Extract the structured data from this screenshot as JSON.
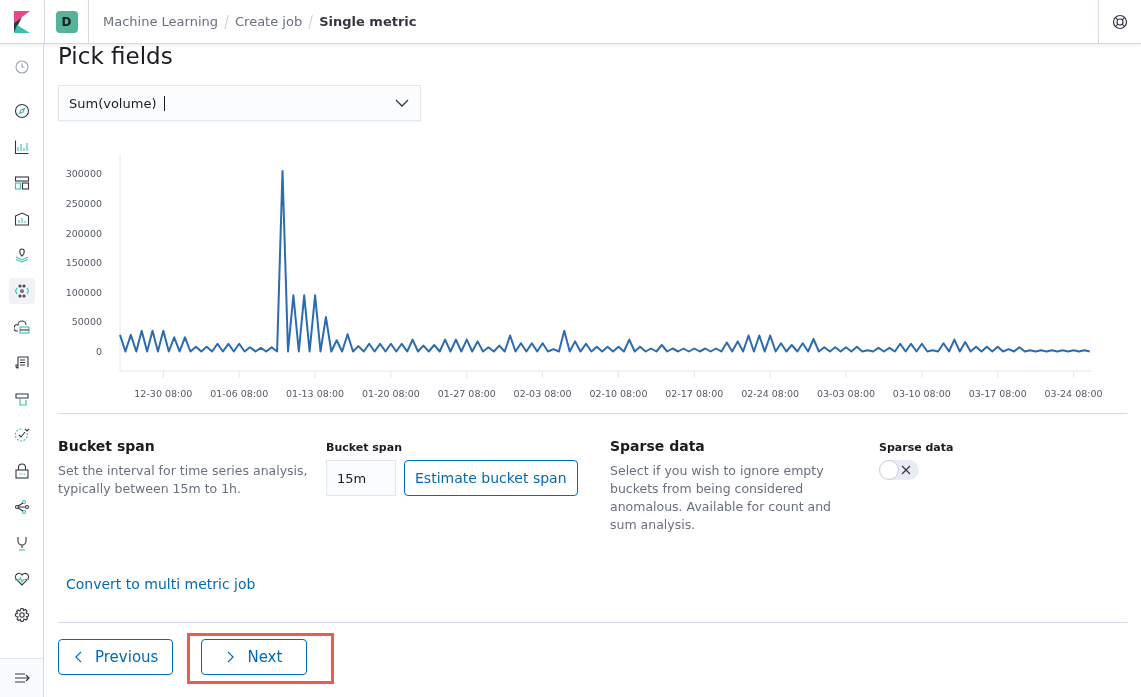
{
  "header": {
    "space_initial": "D",
    "breadcrumbs": [
      {
        "label": "Machine Learning",
        "current": false
      },
      {
        "label": "Create job",
        "current": false
      },
      {
        "label": "Single metric",
        "current": true
      }
    ]
  },
  "sidebar": {
    "items": [
      {
        "selected": false
      },
      {
        "selected": false
      },
      {
        "selected": false
      },
      {
        "selected": false
      },
      {
        "selected": false
      },
      {
        "selected": false
      },
      {
        "selected": true
      },
      {
        "selected": false
      },
      {
        "selected": false
      },
      {
        "selected": false
      },
      {
        "selected": false
      },
      {
        "selected": false
      },
      {
        "selected": false
      },
      {
        "selected": false
      },
      {
        "selected": false
      },
      {
        "selected": false
      }
    ]
  },
  "title": "Pick fields",
  "field_select": {
    "value": "Sum(volume)"
  },
  "chart_data": {
    "type": "line",
    "categories": [
      null,
      null,
      null,
      null,
      null,
      null,
      null,
      null,
      "12-30 08:00",
      null,
      null,
      null,
      null,
      null,
      null,
      null,
      null,
      null,
      null,
      null,
      null,
      null,
      "01-06 08:00",
      null,
      null,
      null,
      null,
      null,
      null,
      null,
      null,
      null,
      null,
      null,
      null,
      null,
      "01-13 08:00",
      null,
      null,
      null,
      null,
      null,
      null,
      null,
      null,
      null,
      null,
      null,
      null,
      null,
      "01-20 08:00",
      null,
      null,
      null,
      null,
      null,
      null,
      null,
      null,
      null,
      null,
      null,
      null,
      null,
      "01-27 08:00",
      null,
      null,
      null,
      null,
      null,
      null,
      null,
      null,
      null,
      null,
      null,
      null,
      null,
      "02-03 08:00",
      null,
      null,
      null,
      null,
      null,
      null,
      null,
      null,
      null,
      null,
      null,
      null,
      null,
      "02-10 08:00",
      null,
      null,
      null,
      null,
      null,
      null,
      null,
      null,
      null,
      null,
      null,
      null,
      null,
      "02-17 08:00",
      null,
      null,
      null,
      null,
      null,
      null,
      null,
      null,
      null,
      null,
      null,
      null,
      null,
      "02-24 08:00",
      null,
      null,
      null,
      null,
      null,
      null,
      null,
      null,
      null,
      null,
      null,
      null,
      null,
      "03-03 08:00",
      null,
      null,
      null,
      null,
      null,
      null,
      null,
      null,
      null,
      null,
      null,
      null,
      null,
      "03-10 08:00",
      null,
      null,
      null,
      null,
      null,
      null,
      null,
      null,
      null,
      null,
      null,
      null,
      null,
      "03-17 08:00",
      null,
      null,
      null,
      null,
      null,
      null,
      null,
      null,
      null,
      null,
      null,
      null,
      null,
      "03-24 08:00",
      null,
      null,
      null
    ],
    "series": [
      {
        "color": "#2b6cb0",
        "values": [
          28000,
          0,
          28000,
          0,
          35000,
          0,
          35000,
          0,
          35000,
          0,
          24000,
          0,
          24000,
          0,
          8000,
          0,
          8000,
          0,
          13000,
          0,
          13000,
          0,
          13000,
          0,
          7000,
          0,
          6000,
          0,
          7000,
          0,
          305000,
          0,
          95000,
          0,
          95000,
          0,
          95000,
          0,
          58000,
          0,
          19000,
          0,
          29000,
          0,
          9000,
          0,
          13000,
          0,
          13000,
          0,
          13000,
          0,
          13000,
          0,
          20000,
          0,
          10000,
          0,
          11000,
          0,
          20000,
          0,
          20000,
          0,
          20000,
          0,
          17000,
          0,
          7000,
          0,
          10000,
          0,
          27000,
          0,
          14000,
          0,
          14000,
          0,
          14000,
          0,
          4000,
          0,
          35000,
          0,
          17000,
          0,
          13000,
          0,
          8000,
          0,
          8000,
          0,
          8000,
          0,
          20000,
          0,
          8000,
          0,
          5000,
          0,
          11000,
          0,
          5000,
          0,
          5000,
          0,
          5000,
          0,
          5000,
          0,
          5000,
          0,
          15000,
          0,
          17000,
          0,
          27000,
          0,
          27000,
          0,
          27000,
          0,
          14000,
          0,
          11000,
          0,
          14000,
          0,
          21000,
          0,
          7000,
          0,
          7000,
          0,
          7000,
          0,
          8000,
          0,
          2000,
          0,
          6000,
          0,
          6000,
          0,
          13000,
          0,
          13000,
          0,
          13000,
          0,
          2000,
          0,
          14000,
          0,
          20000,
          0,
          16000,
          0,
          8000,
          0,
          8000,
          0,
          8000,
          0,
          4000,
          0,
          7000,
          0,
          2000,
          0,
          2000,
          0,
          2000,
          0,
          2000,
          0,
          2000,
          0,
          2000,
          0
        ]
      }
    ],
    "ylim": [
      -33000,
      332000
    ],
    "yticks": [
      0,
      50000,
      100000,
      150000,
      200000,
      250000,
      300000
    ]
  },
  "bucket_span": {
    "title": "Bucket span",
    "description": "Set the interval for time series analysis, typically between 15m to 1h.",
    "field_label": "Bucket span",
    "value": "15m",
    "button": "Estimate bucket span"
  },
  "sparse_data": {
    "title": "Sparse data",
    "description": "Select if you wish to ignore empty buckets from being considered anomalous. Available for count and sum analysis.",
    "switch_label": "Sparse data",
    "on": false
  },
  "convert_link": "Convert to multi metric job",
  "nav_buttons": [
    {
      "label": "Previous",
      "highlighted": false
    },
    {
      "label": "Next",
      "highlighted": true
    }
  ]
}
